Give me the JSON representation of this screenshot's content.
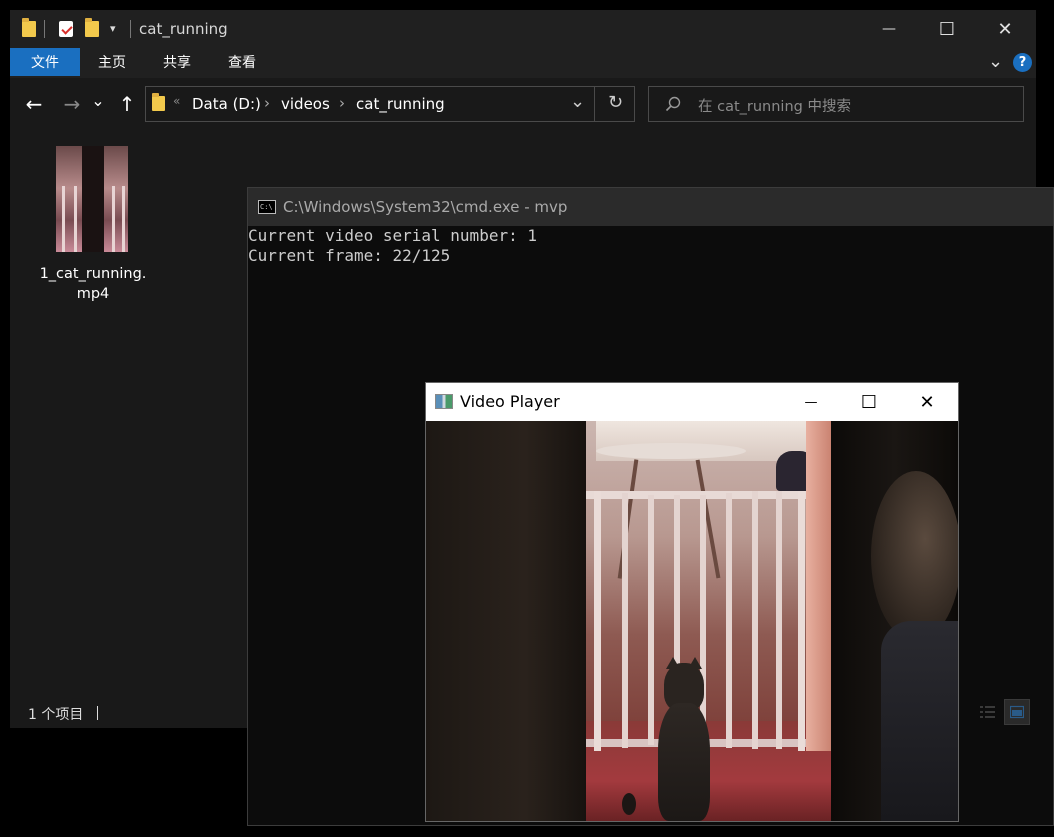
{
  "explorer": {
    "title": "cat_running",
    "quick_access": [
      "folder-icon",
      "properties-icon",
      "new-folder-icon",
      "customize-dropdown-icon"
    ],
    "ribbon_tabs": [
      "文件",
      "主页",
      "共享",
      "查看"
    ],
    "help_label": "?",
    "nav": {
      "back": "←",
      "forward": "→",
      "recent": "⌄",
      "up": "↑",
      "refresh": "↻",
      "dropdown": "⌄"
    },
    "breadcrumb": [
      "Data (D:)",
      "videos",
      "cat_running"
    ],
    "breadcrumb_overflow": "«",
    "search_placeholder": "在 cat_running 中搜索",
    "files": [
      {
        "name_line1": "1_cat_running.",
        "name_line2": "mp4"
      }
    ],
    "status_count": "1 个项目",
    "accent": "#1a6fc0"
  },
  "window_controls": {
    "minimize": "—",
    "maximize": "☐",
    "close": "✕"
  },
  "cmd": {
    "title": "C:\\Windows\\System32\\cmd.exe - mvp",
    "icon_text": "C:\\",
    "lines": [
      "Current video serial number: 1",
      "Current frame: 22/125"
    ]
  },
  "video_player": {
    "title": "Video Player",
    "minimize": "—",
    "maximize": "☐",
    "close": "✕"
  }
}
